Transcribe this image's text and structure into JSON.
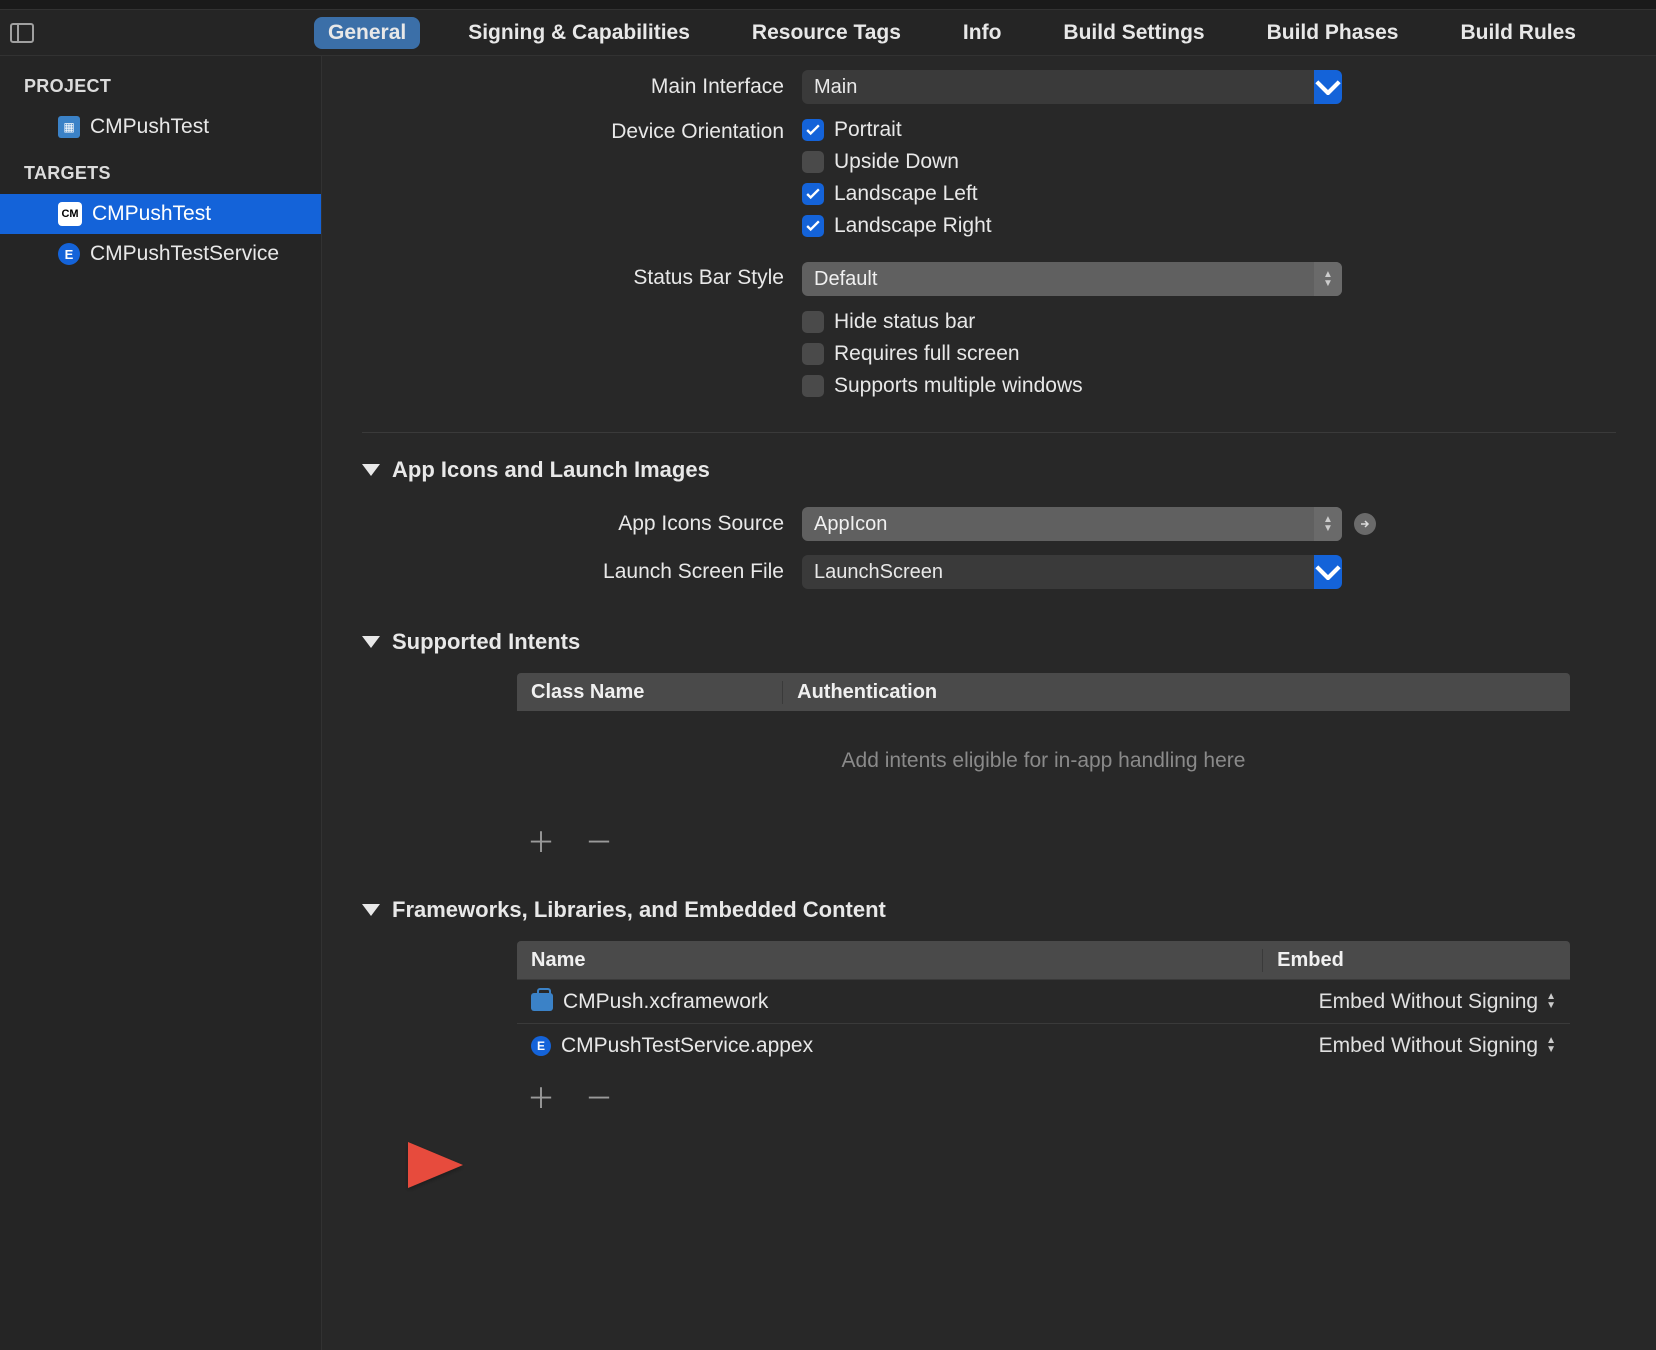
{
  "tabs": {
    "general": "General",
    "signing": "Signing & Capabilities",
    "resource": "Resource Tags",
    "info": "Info",
    "build_settings": "Build Settings",
    "build_phases": "Build Phases",
    "build_rules": "Build Rules"
  },
  "sidebar": {
    "project_head": "PROJECT",
    "project_name": "CMPushTest",
    "targets_head": "TARGETS",
    "target1": "CMPushTest",
    "target2": "CMPushTestService"
  },
  "deployment": {
    "main_interface_label": "Main Interface",
    "main_interface_value": "Main",
    "orientation_label": "Device Orientation",
    "portrait": "Portrait",
    "upside": "Upside Down",
    "land_left": "Landscape Left",
    "land_right": "Landscape Right",
    "status_bar_label": "Status Bar Style",
    "status_bar_value": "Default",
    "hide_status": "Hide status bar",
    "req_full": "Requires full screen",
    "multi_win": "Supports multiple windows"
  },
  "icons": {
    "section": "App Icons and Launch Images",
    "source_label": "App Icons Source",
    "source_value": "AppIcon",
    "launch_label": "Launch Screen File",
    "launch_value": "LaunchScreen"
  },
  "intents": {
    "section": "Supported Intents",
    "col_class": "Class Name",
    "col_auth": "Authentication",
    "placeholder": "Add intents eligible for in-app handling here"
  },
  "frameworks": {
    "section": "Frameworks, Libraries, and Embedded Content",
    "col_name": "Name",
    "col_embed": "Embed",
    "row1_name": "CMPush.xcframework",
    "row1_embed": "Embed Without Signing",
    "row2_name": "CMPushTestService.appex",
    "row2_embed": "Embed Without Signing"
  }
}
